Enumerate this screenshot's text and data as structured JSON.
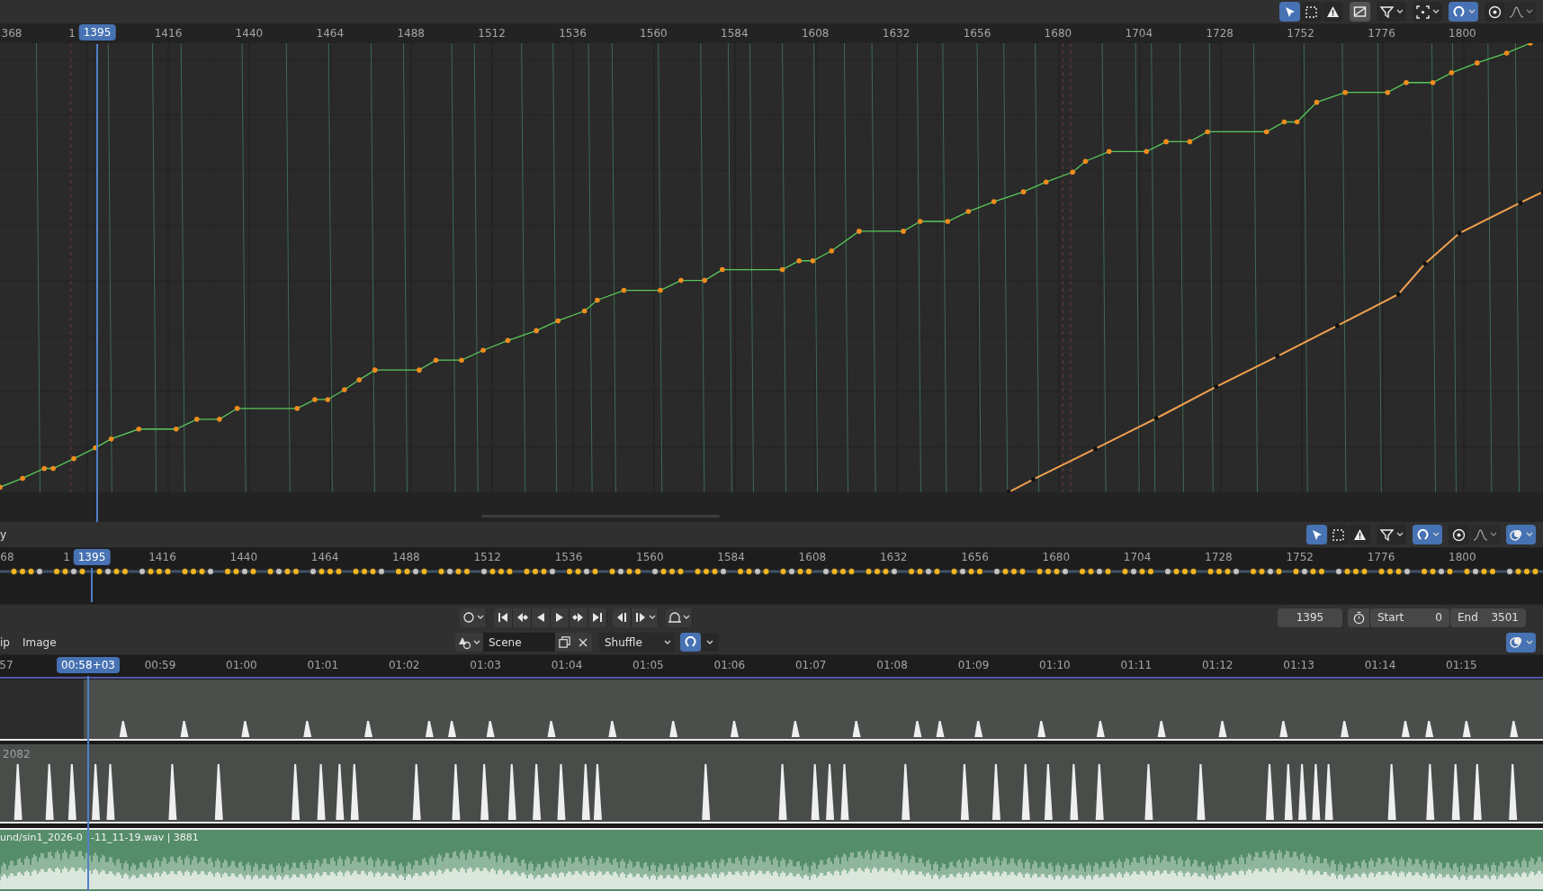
{
  "graph_editor": {
    "header": {
      "tools": [
        {
          "kind": "select",
          "active": true,
          "dropdown": false
        },
        {
          "kind": "box-select",
          "active": false,
          "dropdown": false
        },
        {
          "kind": "warning",
          "active": false,
          "dropdown": false
        },
        {
          "kind": "normalize",
          "active": false,
          "dropdown": false
        },
        {
          "kind": "filter",
          "active": false,
          "dropdown": true
        },
        {
          "kind": "pivot",
          "active": false,
          "dropdown": true
        },
        {
          "kind": "snap",
          "active": true,
          "dropdown": true
        },
        {
          "kind": "proportional",
          "active": false,
          "dropdown": false
        },
        {
          "kind": "falloff",
          "active": false,
          "dropdown": true
        }
      ]
    },
    "ruler": {
      "labels": [
        "368",
        "1",
        "1416",
        "1440",
        "1464",
        "1488",
        "1512",
        "1536",
        "1560",
        "1584",
        "1608",
        "1632",
        "1656",
        "1680",
        "1704",
        "1728",
        "1752",
        "1776",
        "1800"
      ],
      "current_frame": "1395"
    }
  },
  "timeline": {
    "header": {
      "menu": "y",
      "tools": [
        {
          "kind": "select",
          "active": true,
          "dropdown": false
        },
        {
          "kind": "box-select",
          "active": false,
          "dropdown": false
        },
        {
          "kind": "warning",
          "active": false,
          "dropdown": false
        },
        {
          "kind": "filter",
          "active": false,
          "dropdown": true
        },
        {
          "kind": "snap",
          "active": true,
          "dropdown": true
        },
        {
          "kind": "proportional",
          "active": false,
          "dropdown": false
        },
        {
          "kind": "falloff",
          "active": false,
          "dropdown": true
        },
        {
          "kind": "overlay",
          "active": true,
          "dropdown": true
        }
      ]
    },
    "ruler": {
      "labels": [
        "68",
        "1",
        "1416",
        "1440",
        "1464",
        "1488",
        "1512",
        "1536",
        "1560",
        "1584",
        "1608",
        "1632",
        "1656",
        "1680",
        "1704",
        "1728",
        "1752",
        "1776",
        "1800"
      ],
      "current_frame": "1395"
    },
    "playback": {
      "controls": [
        {
          "kind": "record",
          "dropdown": true
        },
        {
          "kind": "jump-start",
          "dropdown": false
        },
        {
          "kind": "prev-key",
          "dropdown": false
        },
        {
          "kind": "play-reverse",
          "dropdown": false
        },
        {
          "kind": "play",
          "dropdown": false
        },
        {
          "kind": "next-key",
          "dropdown": false
        },
        {
          "kind": "jump-end",
          "dropdown": false
        },
        {
          "kind": "prev-marker",
          "dropdown": false
        },
        {
          "kind": "next-marker",
          "dropdown": true
        },
        {
          "kind": "auto-key",
          "dropdown": true
        }
      ],
      "current_frame": "1395",
      "start_label": "Start",
      "start": "0",
      "end_label": "End",
      "end": "3501"
    }
  },
  "sequencer": {
    "header": {
      "menus": [
        "ip",
        "Image"
      ],
      "scene": "Scene",
      "keying": "Shuffle",
      "snap_active": true,
      "tools": [
        {
          "kind": "overlay",
          "active": true,
          "dropdown": true
        }
      ]
    },
    "ruler": {
      "labels": [
        "57",
        "00:59",
        "01:00",
        "01:01",
        "01:02",
        "01:03",
        "01:04",
        "01:05",
        "01:06",
        "01:07",
        "01:08",
        "01:09",
        "01:10",
        "01:11",
        "01:12",
        "01:13",
        "01:14",
        "01:15"
      ],
      "current_time": "00:58+03"
    },
    "strips": [
      {
        "kind": "peaks-small"
      },
      {
        "kind": "peaks-tall",
        "label": "2082"
      },
      {
        "kind": "sound",
        "label_parts": [
          "und/sin1_2026-0",
          "-11_11-19.wav | 3881"
        ]
      }
    ]
  }
}
